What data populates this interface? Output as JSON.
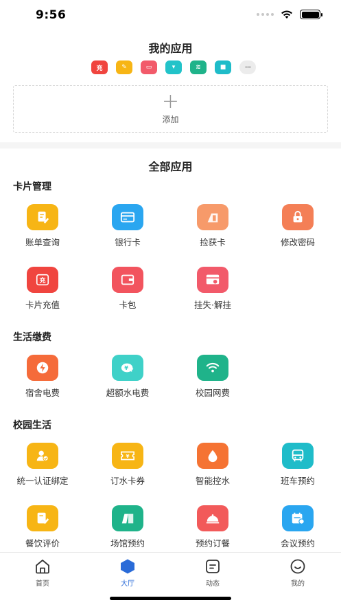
{
  "status": {
    "time": "9:56"
  },
  "my_apps": {
    "title": "我的应用",
    "quick": [
      {
        "icon": "recharge-icon",
        "glyph": "充",
        "color": "#f0453f"
      },
      {
        "icon": "bill-icon",
        "glyph": "✎",
        "color": "#f7b515"
      },
      {
        "icon": "report-loss-icon",
        "glyph": "▭",
        "color": "#f25a6a"
      },
      {
        "icon": "shopping-icon",
        "glyph": "▾",
        "color": "#22c3c9"
      },
      {
        "icon": "wifi-icon",
        "glyph": "≋",
        "color": "#1fb38a"
      },
      {
        "icon": "bus-icon",
        "glyph": "■",
        "color": "#1fbcc9"
      }
    ],
    "more_glyph": "···",
    "add_plus": "+",
    "add_label": "添加"
  },
  "all_apps_title": "全部应用",
  "sections": {
    "card": {
      "title": "卡片管理",
      "apps": [
        {
          "label": "账单查询",
          "icon": "bill-query-icon",
          "color": "#f7b515"
        },
        {
          "label": "银行卡",
          "icon": "bank-card-icon",
          "color": "#2aa6f0"
        },
        {
          "label": "捡获卡",
          "icon": "found-card-icon",
          "color": "#f79a6a"
        },
        {
          "label": "修改密码",
          "icon": "lock-icon",
          "color": "#f47f56"
        },
        {
          "label": "卡片充值",
          "icon": "recharge-icon",
          "color": "#f0453f"
        },
        {
          "label": "卡包",
          "icon": "wallet-icon",
          "color": "#f2545e"
        },
        {
          "label": "挂失·解挂",
          "icon": "report-loss-icon",
          "color": "#f25a6a"
        }
      ]
    },
    "life": {
      "title": "生活缴费",
      "apps": [
        {
          "label": "宿舍电费",
          "icon": "electricity-icon",
          "color": "#f56b3a"
        },
        {
          "label": "超额水电费",
          "icon": "water-electric-fee-icon",
          "color": "#3fd1c8"
        },
        {
          "label": "校园网费",
          "icon": "wifi-icon",
          "color": "#1fb38a"
        }
      ]
    },
    "campus": {
      "title": "校园生活",
      "apps": [
        {
          "label": "统一认证绑定",
          "icon": "user-verify-icon",
          "color": "#f7b515"
        },
        {
          "label": "订水卡券",
          "icon": "coupon-icon",
          "color": "#f7b515"
        },
        {
          "label": "智能控水",
          "icon": "water-drop-icon",
          "color": "#f57333"
        },
        {
          "label": "班车预约",
          "icon": "bus-icon",
          "color": "#1fbcc9"
        },
        {
          "label": "餐饮评价",
          "icon": "review-icon",
          "color": "#f7b515"
        },
        {
          "label": "场馆预约",
          "icon": "venue-icon",
          "color": "#1fb38a"
        },
        {
          "label": "预约订餐",
          "icon": "dining-icon",
          "color": "#f25a5a"
        },
        {
          "label": "会议预约",
          "icon": "meeting-icon",
          "color": "#2aa6f0"
        }
      ]
    }
  },
  "tabs": [
    {
      "label": "首页",
      "icon": "home-icon"
    },
    {
      "label": "大厅",
      "icon": "hall-icon",
      "active_color": "#2a6bd8"
    },
    {
      "label": "动态",
      "icon": "news-icon"
    },
    {
      "label": "我的",
      "icon": "profile-icon"
    }
  ]
}
